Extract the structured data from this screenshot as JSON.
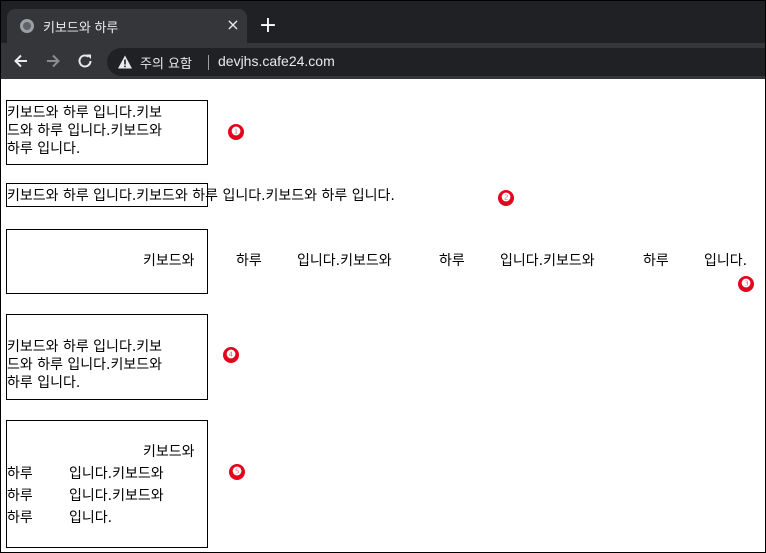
{
  "browser": {
    "tab_title": "키보드와 하루",
    "tab_close": "×",
    "new_tab": "+",
    "security_label": "주의 요함",
    "url": "devjhs.cafe24.com"
  },
  "demos": {
    "text": "키보드와 하루 입니다.키보드와 하루 입니다.키보드와 하루 입니다.",
    "box1_lines": [
      "키보드와 하루 입니다.키보",
      "드와 하루 입니다.키보드와",
      "하루 입니다."
    ],
    "box4_lines": [
      "키보드와 하루 입니다.키보",
      "드와 하루 입니다.키보드와",
      "하루 입니다."
    ],
    "box3_words": [
      "키보드와",
      "하루",
      "입니다.키보드와",
      "하루",
      "입니다.키보드와",
      "하루",
      "입니다."
    ],
    "box5_first": "키보드와",
    "box5_rows": [
      {
        "a": "하루",
        "b": "입니다.키보드와"
      },
      {
        "a": "하루",
        "b": "입니다.키보드와"
      },
      {
        "a": "하루",
        "b": "입니다."
      }
    ]
  },
  "markers": [
    "❶",
    "❷",
    "❸",
    "❹",
    "❺"
  ],
  "colors": {
    "marker": "#e2061c",
    "tabstrip": "#202124",
    "toolbar": "#35363a"
  }
}
